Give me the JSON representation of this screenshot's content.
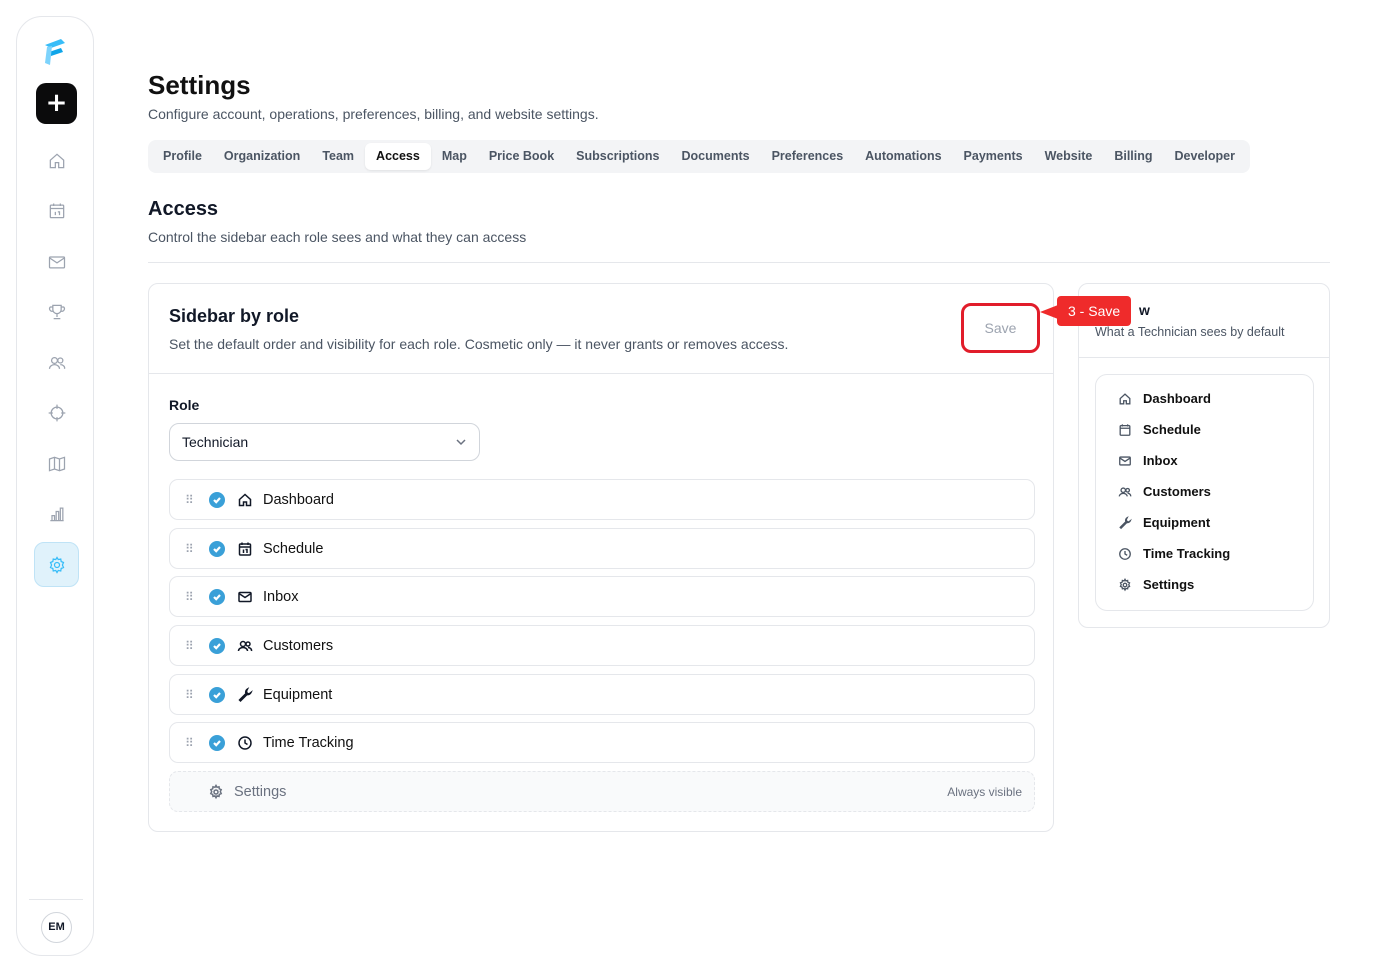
{
  "header": {
    "title": "Settings",
    "subtitle": "Configure account, operations, preferences, billing, and website settings."
  },
  "tabs": [
    {
      "label": "Profile"
    },
    {
      "label": "Organization"
    },
    {
      "label": "Team"
    },
    {
      "label": "Access",
      "active": true
    },
    {
      "label": "Map"
    },
    {
      "label": "Price Book"
    },
    {
      "label": "Subscriptions"
    },
    {
      "label": "Documents"
    },
    {
      "label": "Preferences"
    },
    {
      "label": "Automations"
    },
    {
      "label": "Payments"
    },
    {
      "label": "Website"
    },
    {
      "label": "Billing"
    },
    {
      "label": "Developer"
    }
  ],
  "section": {
    "title": "Access",
    "subtitle": "Control the sidebar each role sees and what they can access"
  },
  "card": {
    "title": "Sidebar by role",
    "subtitle": "Set the default order and visibility for each role. Cosmetic only — it never grants or removes access.",
    "save_label": "Save",
    "role_label": "Role",
    "role_value": "Technician",
    "items": [
      {
        "label": "Dashboard",
        "icon": "home-icon",
        "checked": true
      },
      {
        "label": "Schedule",
        "icon": "calendar-icon",
        "checked": true
      },
      {
        "label": "Inbox",
        "icon": "mail-icon",
        "checked": true
      },
      {
        "label": "Customers",
        "icon": "users-icon",
        "checked": true
      },
      {
        "label": "Equipment",
        "icon": "wrench-icon",
        "checked": true
      },
      {
        "label": "Time Tracking",
        "icon": "clock-icon",
        "checked": true
      }
    ],
    "fixed_item": {
      "label": "Settings",
      "icon": "gear-icon",
      "note": "Always visible"
    }
  },
  "callout": {
    "label": "3 - Save"
  },
  "preview": {
    "title": "w",
    "subtitle": "What a Technician sees by default",
    "items": [
      {
        "label": "Dashboard",
        "icon": "home-icon"
      },
      {
        "label": "Schedule",
        "icon": "calendar-icon"
      },
      {
        "label": "Inbox",
        "icon": "mail-icon"
      },
      {
        "label": "Customers",
        "icon": "users-icon"
      },
      {
        "label": "Equipment",
        "icon": "wrench-icon"
      },
      {
        "label": "Time Tracking",
        "icon": "clock-icon"
      },
      {
        "label": "Settings",
        "icon": "gear-icon"
      }
    ]
  },
  "rail": {
    "new_label": "+",
    "avatar": "EM",
    "icons": [
      "home-icon",
      "calendar-icon",
      "mail-icon",
      "trophy-icon",
      "users-icon",
      "crosshair-icon",
      "map-icon",
      "chart-icon",
      "gear-icon"
    ],
    "active": "gear-icon"
  },
  "colors": {
    "accent": "#38bdf8",
    "check": "#3aa0d8",
    "callout": "#ef2b2b"
  }
}
